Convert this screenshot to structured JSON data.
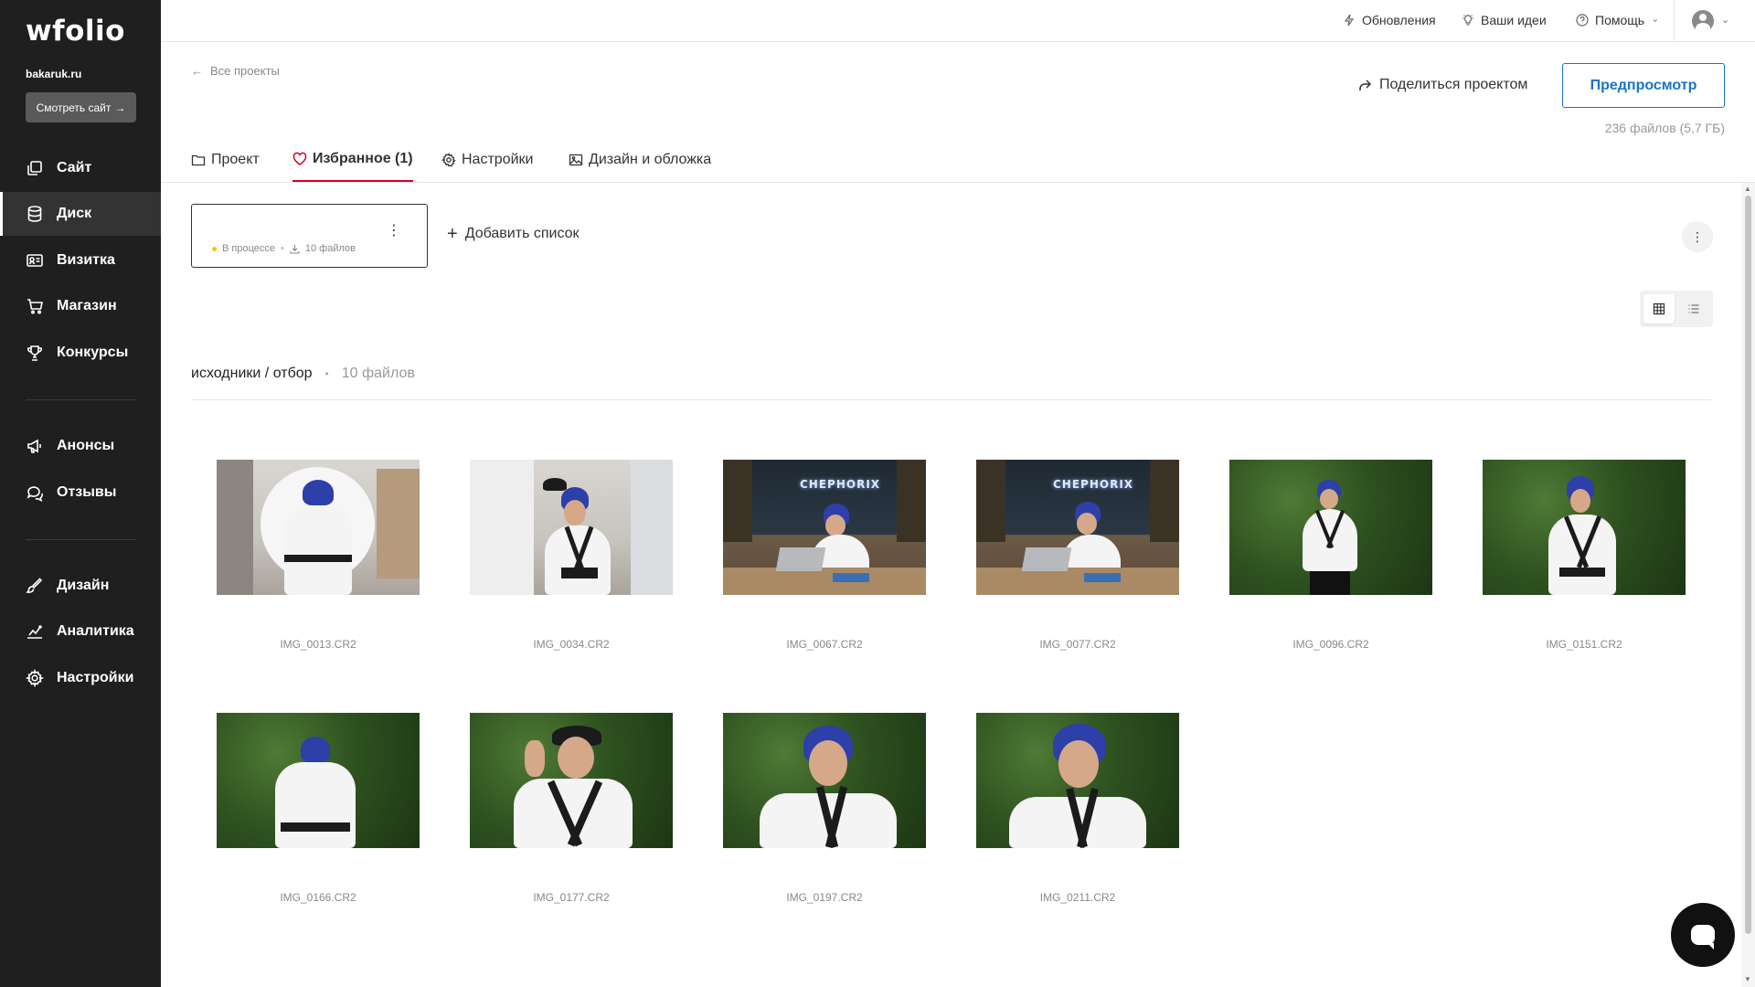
{
  "sidebar": {
    "logo": "wfolio",
    "site_domain": "bakaruk.ru",
    "view_site_label": "Смотреть сайт",
    "view_site_arrow": "→",
    "items": [
      {
        "label": "Сайт",
        "icon": "copy-icon"
      },
      {
        "label": "Диск",
        "icon": "database-icon",
        "active": true
      },
      {
        "label": "Визитка",
        "icon": "id-card-icon"
      },
      {
        "label": "Магазин",
        "icon": "cart-icon"
      },
      {
        "label": "Конкурсы",
        "icon": "trophy-icon"
      },
      {
        "label": "Анонсы",
        "icon": "megaphone-icon"
      },
      {
        "label": "Отзывы",
        "icon": "chat-icon"
      },
      {
        "label": "Дизайн",
        "icon": "brush-icon"
      },
      {
        "label": "Аналитика",
        "icon": "analytics-icon"
      },
      {
        "label": "Настройки",
        "icon": "gear-icon"
      }
    ]
  },
  "topbar": {
    "updates": "Обновления",
    "ideas": "Ваши идеи",
    "help": "Помощь",
    "chevron": "⌄"
  },
  "header": {
    "back_label": "Все проекты",
    "share_label": "Поделиться проектом",
    "preview_label": "Предпросмотр",
    "files_meta": "236 файлов (5,7 ГБ)"
  },
  "tabs": [
    {
      "label": "Проект",
      "icon": "folder-icon"
    },
    {
      "label": "Избранное (1)",
      "icon": "heart-icon",
      "active": true
    },
    {
      "label": "Настройки",
      "icon": "gear-icon"
    },
    {
      "label": "Дизайн и обложка",
      "icon": "image-icon"
    }
  ],
  "list_card": {
    "status": "В процессе",
    "files": "10 файлов",
    "status_color": "#f7c600"
  },
  "add_list_label": "Добавить список",
  "folder": {
    "title": "исходники / отбор",
    "count": "10 файлов"
  },
  "photos": [
    {
      "name": "IMG_0013.CR2",
      "scene": "studio"
    },
    {
      "name": "IMG_0034.CR2",
      "scene": "studio"
    },
    {
      "name": "IMG_0067.CR2",
      "scene": "office"
    },
    {
      "name": "IMG_0077.CR2",
      "scene": "office"
    },
    {
      "name": "IMG_0096.CR2",
      "scene": "forest"
    },
    {
      "name": "IMG_0151.CR2",
      "scene": "forest"
    },
    {
      "name": "IMG_0166.CR2",
      "scene": "forest"
    },
    {
      "name": "IMG_0177.CR2",
      "scene": "forest"
    },
    {
      "name": "IMG_0197.CR2",
      "scene": "forest"
    },
    {
      "name": "IMG_0211.CR2",
      "scene": "forest"
    }
  ],
  "colors": {
    "sidebar_bg": "#1f1f1f",
    "accent_blue": "#1a73c8",
    "tab_active": "#d8002a"
  }
}
